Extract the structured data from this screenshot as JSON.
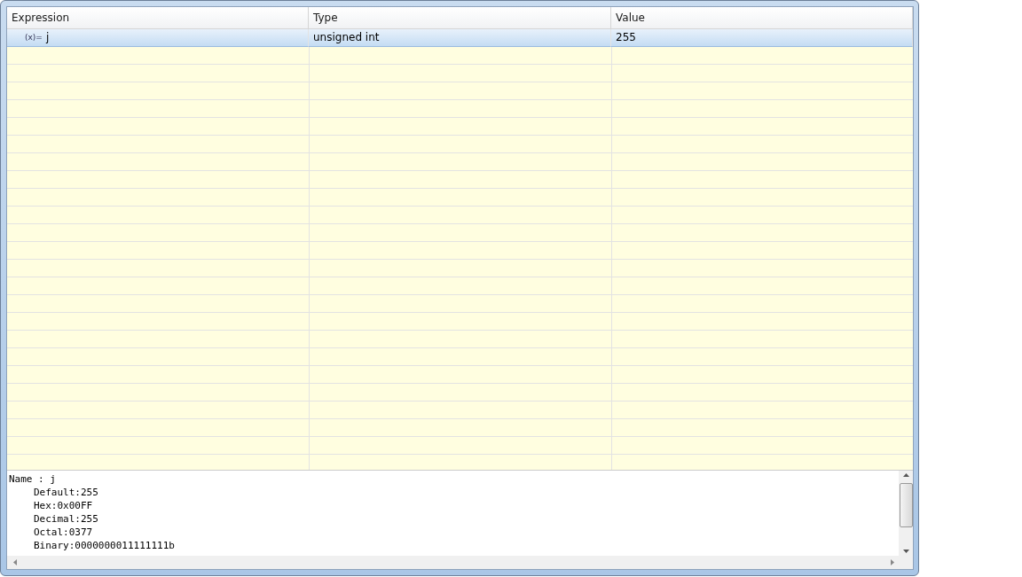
{
  "table": {
    "columns": [
      "Expression",
      "Type",
      "Value"
    ],
    "rows": [
      {
        "icon": "(x)=",
        "expression": "j",
        "type": "unsigned int",
        "value": "255",
        "selected": true
      }
    ]
  },
  "details": {
    "text": "Name : j",
    "children": [
      {
        "text": "Default:255"
      },
      {
        "text": "Hex:0x00FF"
      },
      {
        "text": "Decimal:255"
      },
      {
        "text": "Octal:0377"
      },
      {
        "text": "Binary:0000000011111111b"
      }
    ]
  }
}
